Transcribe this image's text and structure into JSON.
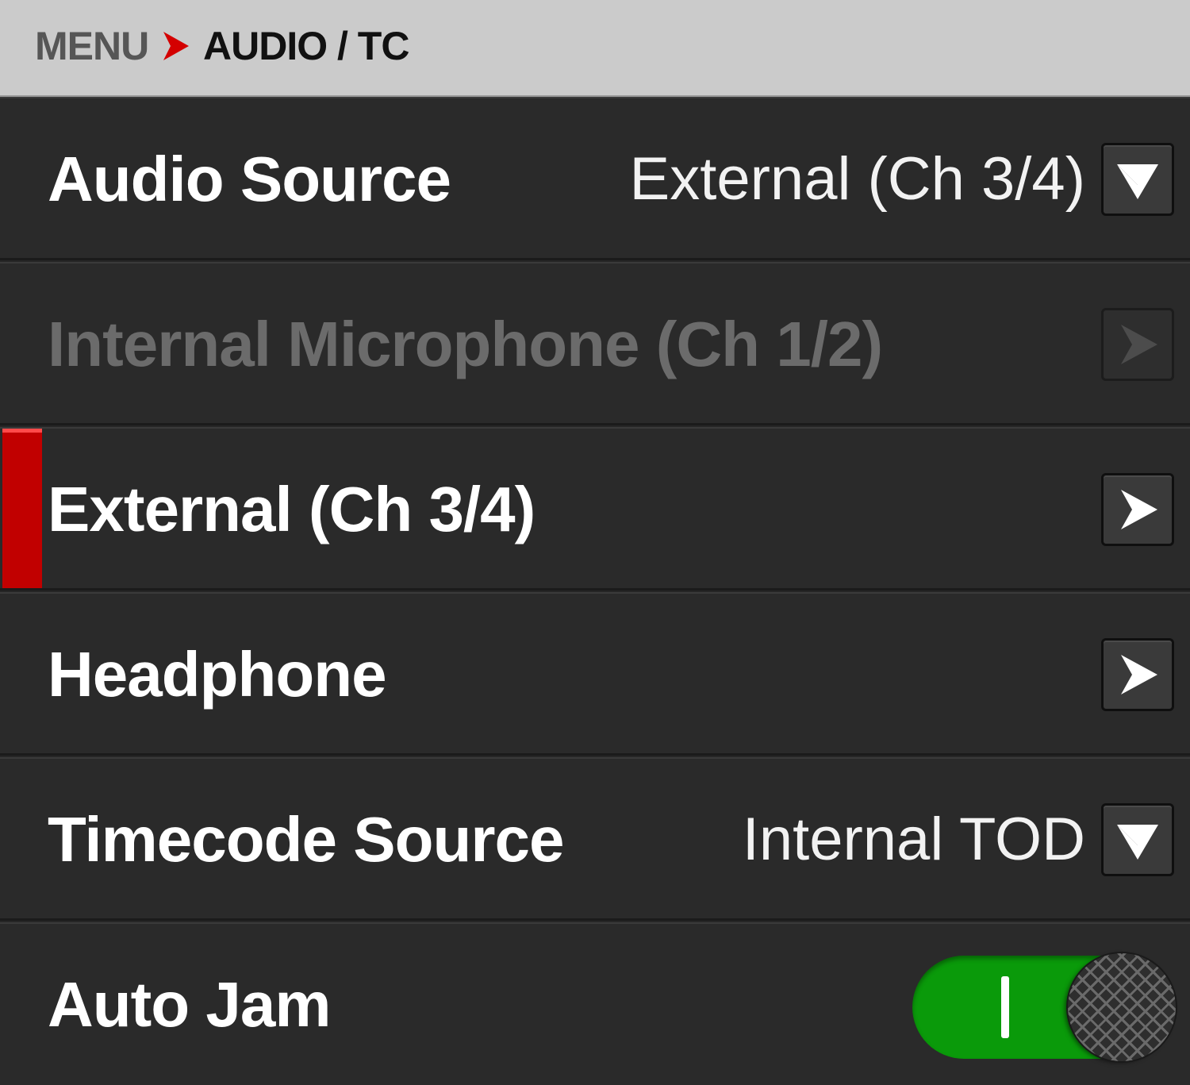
{
  "header": {
    "root": "MENU",
    "separator_icon": "chevron-right-icon",
    "current": "AUDIO / TC",
    "accent_color": "#d40000"
  },
  "rows": {
    "audio_source": {
      "label": "Audio Source",
      "value": "External (Ch 3/4)",
      "control_icon": "chevron-down-icon"
    },
    "internal_mic": {
      "label": "Internal Microphone (Ch 1/2)",
      "state": "disabled",
      "control_icon": "chevron-right-icon"
    },
    "external": {
      "label": "External (Ch 3/4)",
      "state": "selected",
      "control_icon": "chevron-right-icon",
      "selection_color": "#c10000"
    },
    "headphone": {
      "label": "Headphone",
      "control_icon": "chevron-right-icon"
    },
    "timecode_source": {
      "label": "Timecode Source",
      "value": "Internal TOD",
      "control_icon": "chevron-down-icon"
    },
    "auto_jam": {
      "label": "Auto Jam",
      "toggle_on": true,
      "toggle_color": "#0a9a0a"
    }
  }
}
